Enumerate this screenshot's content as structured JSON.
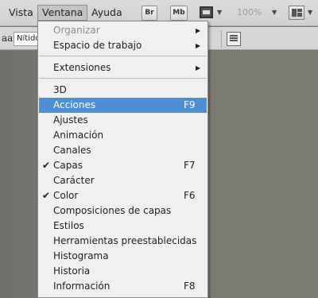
{
  "menubar": {
    "items": [
      "Vista",
      "Ventana",
      "Ayuda"
    ],
    "bridge_label": "Br",
    "minibridge_label": "Mb",
    "zoom": "100%"
  },
  "options": {
    "antialias_icon_label": "aa",
    "antialias_value": "Nítido"
  },
  "menu": {
    "organizar": "Organizar",
    "espacio": "Espacio de trabajo",
    "extensiones": "Extensiones",
    "items": [
      {
        "label": "3D",
        "shortcut": "",
        "checked": false
      },
      {
        "label": "Acciones",
        "shortcut": "F9",
        "checked": false,
        "selected": true
      },
      {
        "label": "Ajustes",
        "shortcut": "",
        "checked": false
      },
      {
        "label": "Animación",
        "shortcut": "",
        "checked": false
      },
      {
        "label": "Canales",
        "shortcut": "",
        "checked": false
      },
      {
        "label": "Capas",
        "shortcut": "F7",
        "checked": true
      },
      {
        "label": "Carácter",
        "shortcut": "",
        "checked": false
      },
      {
        "label": "Color",
        "shortcut": "F6",
        "checked": true
      },
      {
        "label": "Composiciones de capas",
        "shortcut": "",
        "checked": false
      },
      {
        "label": "Estilos",
        "shortcut": "",
        "checked": false
      },
      {
        "label": "Herramientas preestablecidas",
        "shortcut": "",
        "checked": false
      },
      {
        "label": "Histograma",
        "shortcut": "",
        "checked": false
      },
      {
        "label": "Historia",
        "shortcut": "",
        "checked": false
      },
      {
        "label": "Información",
        "shortcut": "F8",
        "checked": false
      }
    ]
  },
  "colors": {
    "highlight": "#4d8fd2",
    "workspace": "#7c7b73"
  }
}
